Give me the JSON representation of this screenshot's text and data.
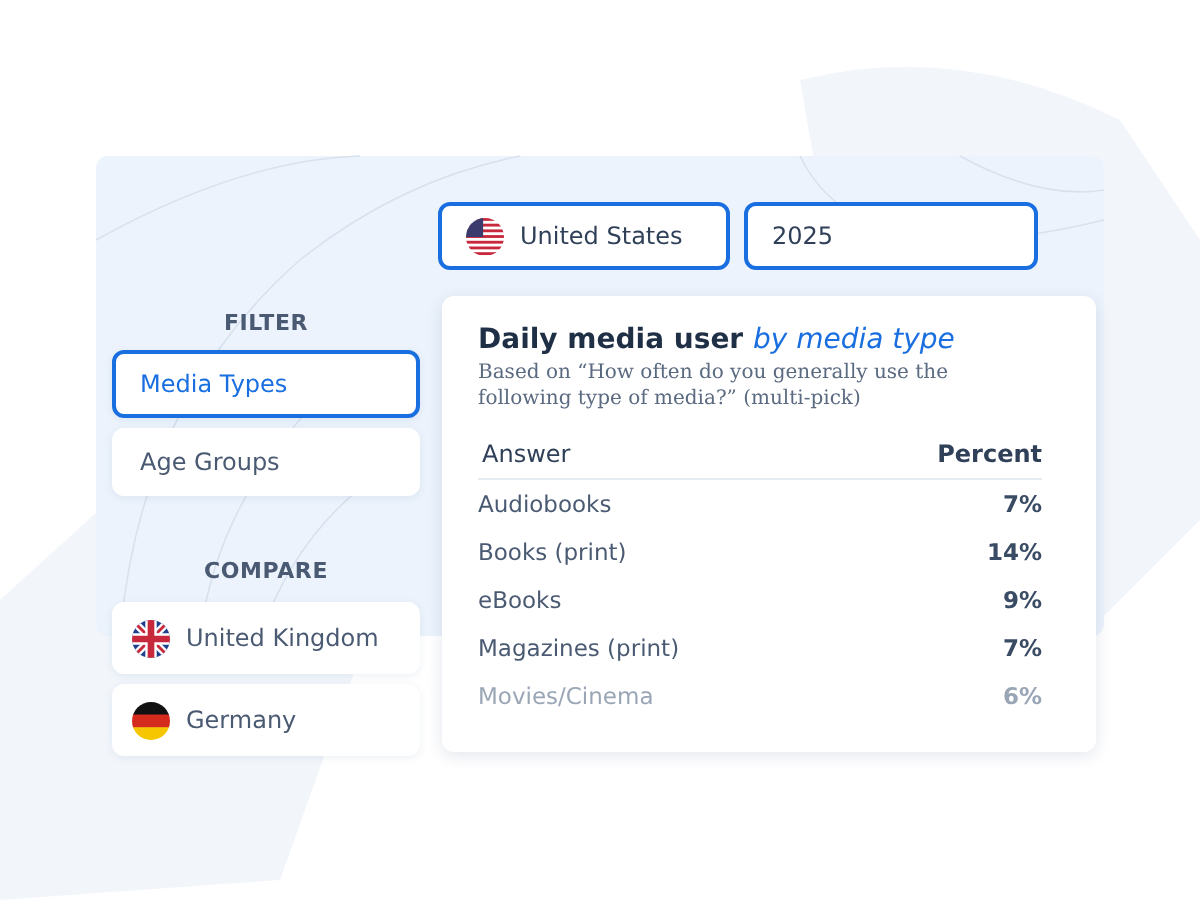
{
  "selectors": {
    "country": {
      "label": "United States",
      "kind": "us"
    },
    "year": {
      "value": "2025"
    }
  },
  "filter": {
    "heading": "FILTER",
    "items": [
      {
        "label": "Media Types",
        "selected": true
      },
      {
        "label": "Age Groups",
        "selected": false
      }
    ]
  },
  "compare": {
    "heading": "COMPARE",
    "items": [
      {
        "label": "United Kingdom",
        "kind": "uk"
      },
      {
        "label": "Germany",
        "kind": "de"
      }
    ]
  },
  "card": {
    "title": "Daily media user *by media type*",
    "subtitle": "Based on “How often do you generally use the following type of media?” (multi-pick)",
    "table": {
      "columns": [
        "Answer",
        "Percent"
      ],
      "rows": [
        {
          "answer": "Audiobooks",
          "percent": "7%",
          "faded": false
        },
        {
          "answer": "Books (print)",
          "percent": "14%",
          "faded": false
        },
        {
          "answer": "eBooks",
          "percent": "9%",
          "faded": false
        },
        {
          "answer": "Magazines (print)",
          "percent": "7%",
          "faded": false
        },
        {
          "answer": "Movies/Cinema",
          "percent": "6%",
          "faded": true
        }
      ]
    }
  }
}
